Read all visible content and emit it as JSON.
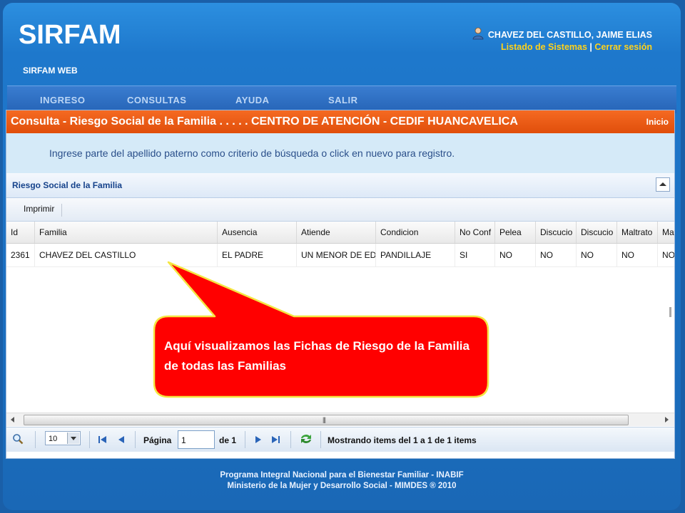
{
  "header": {
    "logo": "SIRFAM",
    "subtitle": "SIRFAM WEB",
    "user_name": "CHAVEZ DEL CASTILLO, JAIME ELIAS",
    "link_systems": "Listado de Sistemas",
    "link_separator": "|",
    "link_logout": "Cerrar sesión"
  },
  "menu": [
    "INGRESO",
    "CONSULTAS",
    "AYUDA",
    "SALIR"
  ],
  "panel": {
    "title": "Consulta - Riesgo Social de la Familia . . . . . CENTRO DE ATENCIÓN - CEDIF HUANCAVELICA",
    "home_link": "Inicio",
    "instruction": "Ingrese parte del apellido paterno como criterio de búsqueda o click en nuevo para registro."
  },
  "grid": {
    "title": "Riesgo Social de la Familia",
    "print_label": "Imprimir",
    "columns": [
      "Id",
      "Familia",
      "Ausencia",
      "Atiende",
      "Condicion",
      "No Conf",
      "Pelea",
      "Discucio",
      "Discucio",
      "Maltrato",
      "Ma"
    ],
    "rows": [
      [
        "2361",
        "CHAVEZ DEL CASTILLO",
        "EL PADRE",
        "UN MENOR DE ED",
        "PANDILLAJE",
        "SI",
        "NO",
        "NO",
        "NO",
        "NO",
        "NO"
      ]
    ]
  },
  "pager": {
    "page_size": "10",
    "page_label": "Página",
    "page_value": "1",
    "of_label": "de 1",
    "status": "Mostrando items del 1 a 1 de 1 items"
  },
  "footer": {
    "line1": "Programa Integral Nacional para el Bienestar Familiar - INABIF",
    "line2": "Ministerio de la Mujer y Desarrollo Social - MIMDES ® 2010"
  },
  "callout": {
    "text": "Aquí visualizamos las Fichas de Riesgo de la Familia de todas las Familias"
  },
  "colors": {
    "title_bar": "#e85a12",
    "menu_bar": "#2f6fc2",
    "accent_link": "#ffd21a",
    "callout_fill": "#ff0000",
    "callout_border": "#f5e642"
  }
}
